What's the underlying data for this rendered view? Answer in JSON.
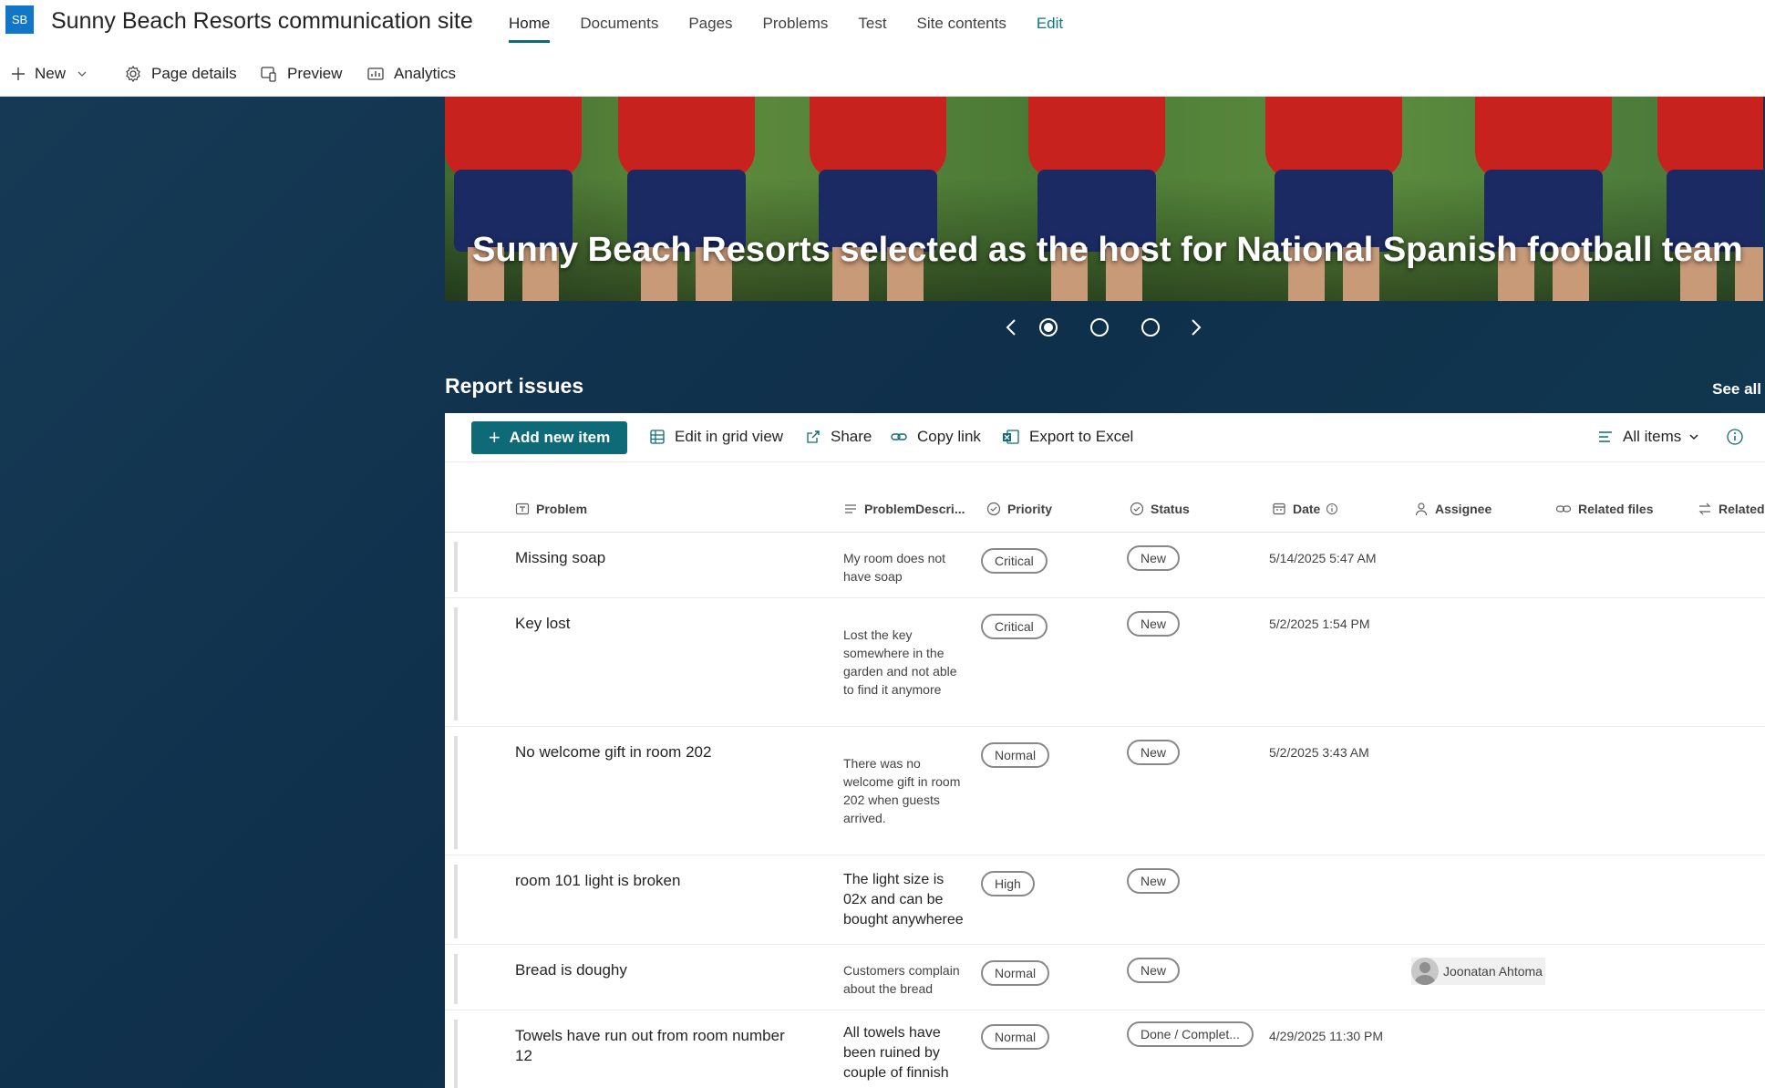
{
  "site": {
    "logo_text": "SB",
    "title": "Sunny Beach Resorts communication site",
    "nav": [
      "Home",
      "Documents",
      "Pages",
      "Problems",
      "Test",
      "Site contents"
    ],
    "edit_label": "Edit"
  },
  "command_bar": {
    "new_label": "New",
    "page_details_label": "Page details",
    "preview_label": "Preview",
    "analytics_label": "Analytics"
  },
  "hero": {
    "title": "Sunny Beach Resorts selected as the host for National Spanish football team",
    "slide_count": 3,
    "active_slide": 1
  },
  "report_issues": {
    "title": "Report issues",
    "see_all_label": "See all",
    "toolbar": {
      "add_label": "Add new item",
      "grid_label": "Edit in grid view",
      "share_label": "Share",
      "copy_label": "Copy link",
      "export_label": "Export to Excel",
      "view_label": "All items"
    },
    "columns": {
      "problem": "Problem",
      "description": "ProblemDescri...",
      "priority": "Priority",
      "status": "Status",
      "date": "Date",
      "assignee": "Assignee",
      "related_files": "Related files",
      "related": "Related"
    },
    "rows": [
      {
        "problem": "Missing soap",
        "description": "My room does not have soap",
        "priority": "Critical",
        "status": "New",
        "date": "5/14/2025 5:47 AM",
        "assignee": ""
      },
      {
        "problem": "Key lost",
        "description": "Lost the key somewhere in the garden and not able to find it anymore",
        "priority": "Critical",
        "status": "New",
        "date": "5/2/2025 1:54 PM",
        "assignee": ""
      },
      {
        "problem": "No welcome gift in room 202",
        "description": "There was no welcome gift in room 202 when guests arrived.",
        "priority": "Normal",
        "status": "New",
        "date": "5/2/2025 3:43 AM",
        "assignee": ""
      },
      {
        "problem": "room 101 light is broken",
        "description": "The light size is 02x and can be bought anywheree",
        "priority": "High",
        "status": "New",
        "date": "",
        "assignee": ""
      },
      {
        "problem": "Bread is doughy",
        "description": "Customers complain about the bread",
        "priority": "Normal",
        "status": "New",
        "date": "",
        "assignee": "Joonatan Ahtoma"
      },
      {
        "problem": "Towels have run out from room number 12",
        "description": "All towels have been ruined by couple of finnish",
        "priority": "Normal",
        "status": "Done / Complet...",
        "date": "4/29/2025 11:30 PM",
        "assignee": ""
      }
    ]
  },
  "colors": {
    "accent": "#0f6a77",
    "page_background": "#12344f",
    "logo": "#1176c8"
  }
}
